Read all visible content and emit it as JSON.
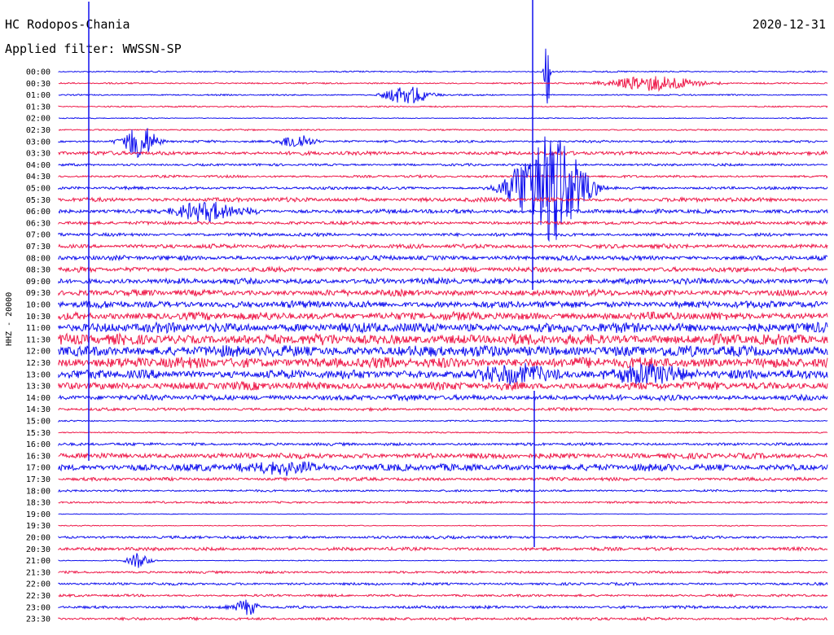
{
  "header": {
    "station": "HC Rodopos-Chania",
    "date": "2020-12-31",
    "filter": "Applied filter: WWSSN-SP"
  },
  "channel_label": "HHZ - 20000",
  "colors": {
    "even_row": "#1010ee",
    "odd_row": "#ee1a4a",
    "background": "#ffffff",
    "text": "#000000"
  },
  "chart_data": {
    "type": "line",
    "title": "HC Rodopos-Chania",
    "subtitle": "Applied filter: WWSSN-SP",
    "ylabel": "HHZ - 20000",
    "y_tick_labels": [
      "00:00",
      "00:30",
      "01:00",
      "01:30",
      "02:00",
      "02:30",
      "03:00",
      "03:30",
      "04:00",
      "04:30",
      "05:00",
      "05:30",
      "06:00",
      "06:30",
      "07:00",
      "07:30",
      "08:00",
      "08:30",
      "09:00",
      "09:30",
      "10:00",
      "10:30",
      "11:00",
      "11:30",
      "12:00",
      "12:30",
      "13:00",
      "13:30",
      "14:00",
      "14:30",
      "15:00",
      "15:30",
      "16:00",
      "16:30",
      "17:00",
      "17:30",
      "18:00",
      "18:30",
      "19:00",
      "19:30",
      "20:00",
      "20:30",
      "21:00",
      "21:30",
      "22:00",
      "22:30",
      "23:00",
      "23:30"
    ],
    "row_noise_level": [
      0.6,
      0.6,
      0.6,
      0.6,
      0.4,
      0.6,
      1.0,
      1.6,
      1.0,
      1.0,
      1.2,
      1.8,
      1.8,
      1.4,
      1.4,
      1.8,
      2.0,
      2.0,
      2.4,
      2.6,
      3.0,
      3.4,
      4.2,
      4.6,
      4.8,
      4.6,
      3.8,
      3.4,
      2.4,
      1.2,
      0.6,
      0.6,
      1.2,
      2.4,
      3.0,
      1.4,
      0.9,
      0.9,
      0.3,
      0.4,
      1.2,
      1.4,
      0.4,
      1.0,
      1.1,
      1.0,
      1.2,
      1.2
    ],
    "events": [
      {
        "row": 0,
        "x_frac": 0.635,
        "amp": 90,
        "dur": 0.002
      },
      {
        "row": 1,
        "x_frac": 0.775,
        "amp": 10,
        "dur": 0.04
      },
      {
        "row": 2,
        "x_frac": 0.453,
        "amp": 12,
        "dur": 0.02
      },
      {
        "row": 6,
        "x_frac": 0.105,
        "amp": 22,
        "dur": 0.015
      },
      {
        "row": 6,
        "x_frac": 0.31,
        "amp": 10,
        "dur": 0.015
      },
      {
        "row": 10,
        "x_frac": 0.637,
        "amp": 70,
        "dur": 0.03
      },
      {
        "row": 12,
        "x_frac": 0.195,
        "amp": 12,
        "dur": 0.03
      },
      {
        "row": 26,
        "x_frac": 0.59,
        "amp": 12,
        "dur": 0.03
      },
      {
        "row": 26,
        "x_frac": 0.77,
        "amp": 14,
        "dur": 0.03
      },
      {
        "row": 34,
        "x_frac": 0.29,
        "amp": 10,
        "dur": 0.03
      },
      {
        "row": 42,
        "x_frac": 0.105,
        "amp": 10,
        "dur": 0.01
      },
      {
        "row": 46,
        "x_frac": 0.245,
        "amp": 10,
        "dur": 0.01
      }
    ]
  }
}
